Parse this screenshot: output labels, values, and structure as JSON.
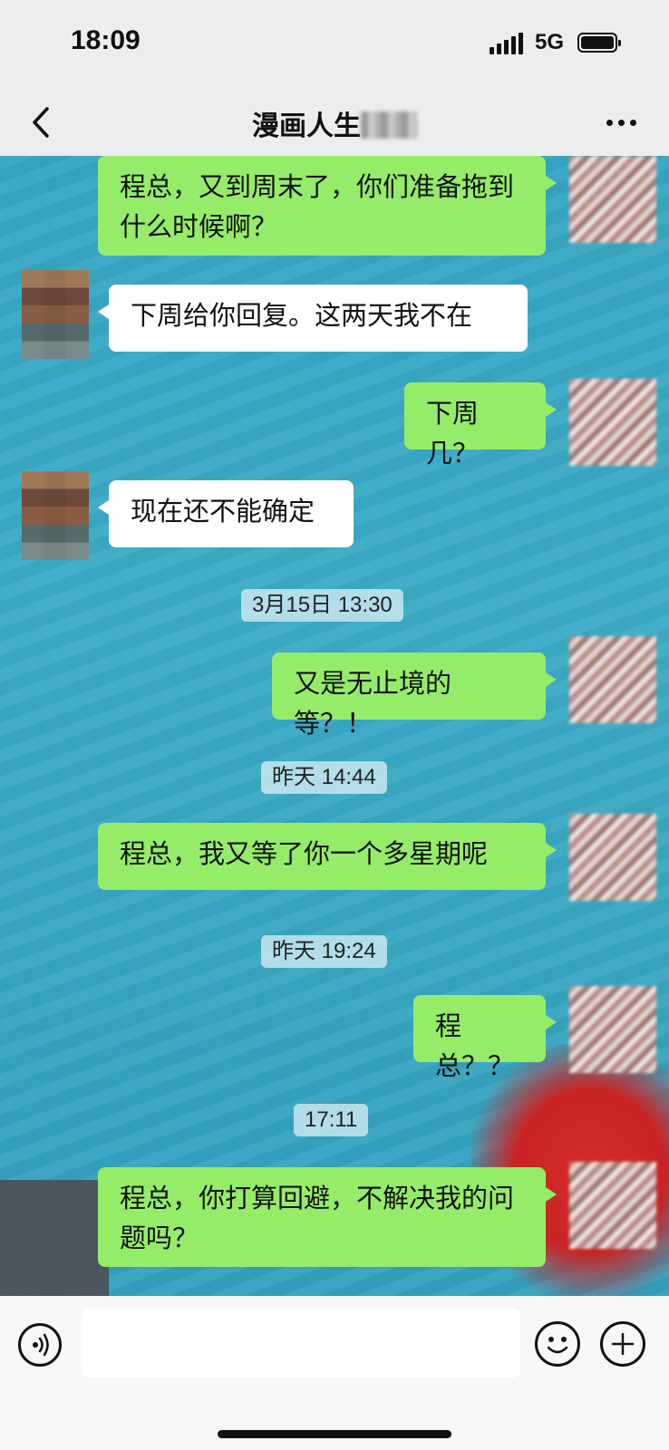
{
  "status_bar": {
    "time": "18:09",
    "network": "5G",
    "battery_icon": "battery-full-icon"
  },
  "navbar": {
    "title": "漫画人生",
    "back_icon": "chevron-left-icon",
    "more_icon": "more-dots-icon"
  },
  "messages": [
    {
      "from": "me",
      "text": "程总，又到周末了，你们准备拖到什么时候啊？"
    },
    {
      "from": "other",
      "text": "下周给你回复。这两天我不在"
    },
    {
      "from": "me",
      "text": "下周几？"
    },
    {
      "from": "other",
      "text": "现在还不能确定"
    },
    {
      "from": "me",
      "text": "又是无止境的等？！"
    },
    {
      "from": "me",
      "text": "程总，我又等了你一个多星期呢"
    },
    {
      "from": "me",
      "text": "程总？？"
    },
    {
      "from": "me",
      "text": "程总，你打算回避，不解决我的问题吗？"
    }
  ],
  "timestamps": [
    "3月15日 13:30",
    "昨天 14:44",
    "昨天 19:24",
    "17:11"
  ],
  "input_bar": {
    "voice_icon": "voice-icon",
    "emoji_icon": "emoji-icon",
    "plus_icon": "plus-icon",
    "input_value": ""
  },
  "colors": {
    "outgoing_bubble": "#95ec69",
    "incoming_bubble": "#ffffff",
    "chat_background": "#3aa8c4",
    "bar_background": "#ededed"
  }
}
